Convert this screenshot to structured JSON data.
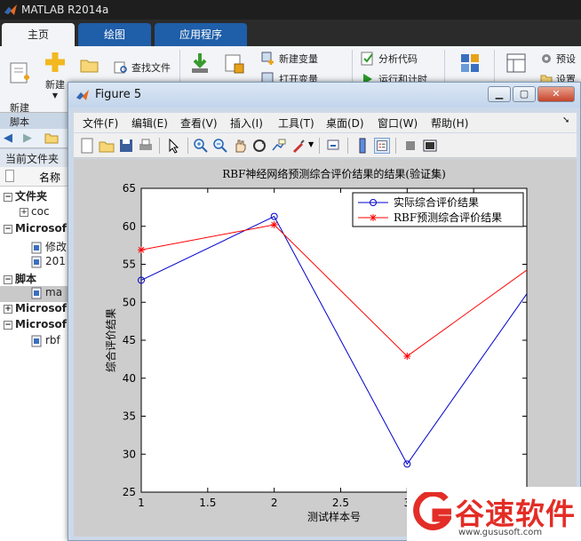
{
  "app": {
    "title": "MATLAB R2014a"
  },
  "tabs": [
    {
      "label": "主页",
      "active": true
    },
    {
      "label": "绘图",
      "active": false
    },
    {
      "label": "应用程序",
      "active": false
    }
  ],
  "ribbon": {
    "new_script": "新建\n脚本",
    "new": "新建",
    "find_files": "查找文件",
    "new_variable": "新建变量",
    "open_variable": "打开变量",
    "analyze_code": "分析代码",
    "run_and_time": "运行和计时",
    "preferences": "预设",
    "set_path": "设置"
  },
  "sidebar": {
    "panel_title": "当前文件夹",
    "column_name": "名称",
    "rows": [
      {
        "label": "文件夹",
        "bold": true,
        "toggle": "−"
      },
      {
        "label": "coc",
        "bold": false,
        "toggle": "+"
      },
      {
        "label": "Microsof",
        "bold": true,
        "toggle": "−"
      },
      {
        "label": "修改",
        "bold": false,
        "toggle": ""
      },
      {
        "label": "201",
        "bold": false,
        "toggle": ""
      },
      {
        "label": "脚本",
        "bold": true,
        "toggle": "−"
      },
      {
        "label": "ma",
        "bold": false,
        "toggle": ""
      },
      {
        "label": "Microsof",
        "bold": true,
        "toggle": "+"
      },
      {
        "label": "Microsof",
        "bold": true,
        "toggle": "−"
      },
      {
        "label": "rbf",
        "bold": false,
        "toggle": ""
      }
    ]
  },
  "figure": {
    "window_title": "Figure 5",
    "menus": [
      "文件(F)",
      "编辑(E)",
      "查看(V)",
      "插入(I)",
      "工具(T)",
      "桌面(D)",
      "窗口(W)",
      "帮助(H)"
    ]
  },
  "chart_data": {
    "type": "line",
    "title": "RBF神经网络预测综合评价结果的结果(验证集)",
    "xlabel": "测试样本号",
    "ylabel": "综合评价结果",
    "xlim": [
      1,
      3.9
    ],
    "ylim": [
      25,
      65
    ],
    "xticks": [
      "1",
      "1.5",
      "2",
      "2.5",
      "3",
      "3"
    ],
    "yticks": [
      "25",
      "30",
      "35",
      "40",
      "45",
      "50",
      "55",
      "60",
      "65"
    ],
    "x": [
      1,
      2,
      3,
      4
    ],
    "series": [
      {
        "name": "实际综合评价结果",
        "values": [
          52.9,
          61.3,
          28.7,
          53.6
        ],
        "color": "#0000cc",
        "marker": "circle"
      },
      {
        "name": "RBF预测综合评价结果",
        "values": [
          56.9,
          60.2,
          42.9,
          55.5
        ],
        "color": "#ff0000",
        "marker": "star"
      }
    ],
    "legend": "top-right",
    "grid": false
  },
  "watermark": {
    "text": "谷速软件",
    "url": "www.gususoft.com"
  },
  "colors": {
    "accent": "#1f5ea8",
    "series1": "#0000cc",
    "series2": "#ff0000",
    "watermark": "#e32d26"
  }
}
